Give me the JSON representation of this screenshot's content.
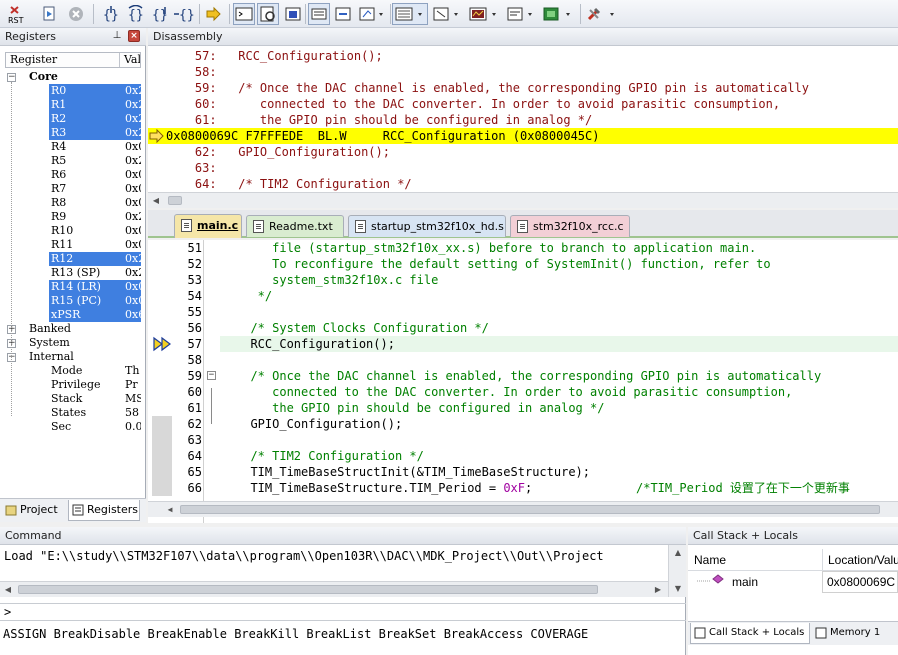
{
  "toolbar": {
    "rst_label": "RST",
    "buttons": [
      "reset-button",
      "run-button",
      "stop-button",
      "step-into-button",
      "step-over-button",
      "step-out-button",
      "run-to-cursor-button",
      "show-next-statement-button",
      "command-window-button",
      "disassembly-window-button",
      "symbols-window-button",
      "registers-window-button",
      "call-stack-button",
      "watch-window-button",
      "memory-window-button",
      "serial-window-button",
      "analysis-window-button",
      "trace-window-button",
      "system-viewer-button",
      "toolbox-button"
    ]
  },
  "registers": {
    "title": "Registers",
    "col_register": "Register",
    "col_value": "Value",
    "groups": {
      "core": "Core",
      "banked": "Banked",
      "system": "System",
      "internal": "Internal"
    },
    "core_rows": [
      {
        "name": "R0",
        "value": "0x2",
        "selected": true
      },
      {
        "name": "R1",
        "value": "0x2",
        "selected": true
      },
      {
        "name": "R2",
        "value": "0x2",
        "selected": true
      },
      {
        "name": "R3",
        "value": "0x2",
        "selected": true
      },
      {
        "name": "R4",
        "value": "0x0",
        "selected": false
      },
      {
        "name": "R5",
        "value": "0x2",
        "selected": false
      },
      {
        "name": "R6",
        "value": "0x0",
        "selected": false
      },
      {
        "name": "R7",
        "value": "0x0",
        "selected": false
      },
      {
        "name": "R8",
        "value": "0x0",
        "selected": false
      },
      {
        "name": "R9",
        "value": "0x2",
        "selected": false
      },
      {
        "name": "R10",
        "value": "0x0",
        "selected": false
      },
      {
        "name": "R11",
        "value": "0x0",
        "selected": false
      },
      {
        "name": "R12",
        "value": "0x2",
        "selected": true
      },
      {
        "name": "R13 (SP)",
        "value": "0x2",
        "selected": false
      },
      {
        "name": "R14 (LR)",
        "value": "0x0",
        "selected": true
      },
      {
        "name": "R15 (PC)",
        "value": "0x0",
        "selected": true
      },
      {
        "name": "xPSR",
        "value": "0x6",
        "selected": true
      }
    ],
    "internal_rows": [
      {
        "name": "Mode",
        "value": "Th"
      },
      {
        "name": "Privilege",
        "value": "Pr"
      },
      {
        "name": "Stack",
        "value": "MS"
      },
      {
        "name": "States",
        "value": "58"
      },
      {
        "name": "Sec",
        "value": "0.0"
      }
    ],
    "tab_project": "Project",
    "tab_registers": "Registers"
  },
  "disassembly": {
    "title": "Disassembly",
    "lines": [
      {
        "text": "    57:   RCC_Configuration();",
        "hl": false
      },
      {
        "text": "    58:",
        "hl": false
      },
      {
        "text": "    59:   /* Once the DAC channel is enabled, the corresponding GPIO pin is automatically",
        "hl": false
      },
      {
        "text": "    60:      connected to the DAC converter. In order to avoid parasitic consumption,",
        "hl": false
      },
      {
        "text": "    61:      the GPIO pin should be configured in analog */",
        "hl": false
      },
      {
        "text": "0x0800069C F7FFFEDE  BL.W     RCC_Configuration (0x0800045C)",
        "hl": true
      },
      {
        "text": "    62:   GPIO_Configuration();",
        "hl": false
      },
      {
        "text": "    63:",
        "hl": false
      },
      {
        "text": "    64:   /* TIM2 Configuration */",
        "hl": false
      }
    ]
  },
  "tabs": [
    {
      "label": "main.c",
      "active": true,
      "color": "#f5e6a8"
    },
    {
      "label": "Readme.txt",
      "active": false,
      "color": "#d9ecd0"
    },
    {
      "label": "startup_stm32f10x_hd.s",
      "active": false,
      "color": "#d7e4f3"
    },
    {
      "label": "stm32f10x_rcc.c",
      "active": false,
      "color": "#f2cfd6"
    }
  ],
  "editor": {
    "lines": [
      {
        "num": "51",
        "text": "     file (startup_stm32f10x_xx.s) before to branch to application main.",
        "type": "cmt"
      },
      {
        "num": "52",
        "text": "     To reconfigure the default setting of SystemInit() function, refer to",
        "type": "cmt"
      },
      {
        "num": "53",
        "text": "     system_stm32f10x.c file",
        "type": "cmt"
      },
      {
        "num": "54",
        "text": "   */",
        "type": "cmt"
      },
      {
        "num": "55",
        "text": "",
        "type": "code"
      },
      {
        "num": "56",
        "text": "  /* System Clocks Configuration */",
        "type": "cmt"
      },
      {
        "num": "57",
        "text": "  RCC_Configuration();",
        "type": "cur"
      },
      {
        "num": "58",
        "text": "",
        "type": "code"
      },
      {
        "num": "59",
        "text": "  /* Once the DAC channel is enabled, the corresponding GPIO pin is automatically",
        "type": "cmt"
      },
      {
        "num": "60",
        "text": "     connected to the DAC converter. In order to avoid parasitic consumption,",
        "type": "cmt"
      },
      {
        "num": "61",
        "text": "     the GPIO pin should be configured in analog */",
        "type": "cmt"
      },
      {
        "num": "62",
        "text": "  GPIO_Configuration();",
        "type": "code"
      },
      {
        "num": "63",
        "text": "",
        "type": "code"
      },
      {
        "num": "64",
        "text": "  /* TIM2 Configuration */",
        "type": "cmt"
      },
      {
        "num": "65",
        "text": "  TIM_TimeBaseStructInit(&TIM_TimeBaseStructure);",
        "type": "code"
      },
      {
        "num": "66",
        "text": "  TIM_TimeBaseStructure.TIM_Period = 0xF;",
        "type": "code"
      }
    ],
    "line66_comment": "/*TIM_Period 设置了在下一个更新事",
    "line66_hex": "0xF"
  },
  "command": {
    "title": "Command",
    "output": "Load \"E:\\\\study\\\\STM32F107\\\\data\\\\program\\\\Open103R\\\\DAC\\\\MDK_Project\\\\Out\\\\Project",
    "prompt": ">",
    "help": "ASSIGN BreakDisable BreakEnable BreakKill BreakList BreakSet BreakAccess COVERAGE"
  },
  "callstack": {
    "title": "Call Stack + Locals",
    "col_name": "Name",
    "col_location": "Location/Value",
    "rows": [
      {
        "name": "main",
        "location": "0x0800069C"
      }
    ],
    "tab_callstack": "Call Stack + Locals",
    "tab_memory": "Memory 1"
  },
  "colors": {
    "selection": "#3f7fe0",
    "disasm_highlight": "#ffff00",
    "current_line": "#e8f7ea",
    "comment": "#008000",
    "disasm_source": "#8b1010"
  }
}
